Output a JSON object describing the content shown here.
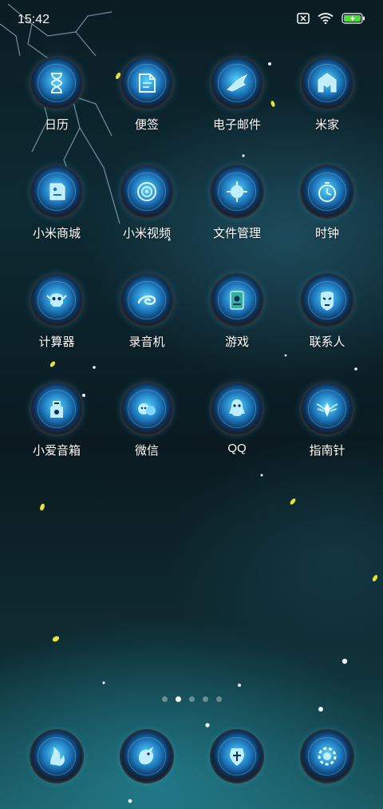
{
  "status_bar": {
    "time": "15:42",
    "icons": [
      "sim-off-icon",
      "wifi-icon",
      "battery-charging-icon"
    ],
    "battery_color": "#4ddc3a"
  },
  "apps": [
    {
      "label": "日历",
      "icon": "hourglass-icon"
    },
    {
      "label": "便签",
      "icon": "note-icon"
    },
    {
      "label": "电子邮件",
      "icon": "wing-mail-icon"
    },
    {
      "label": "米家",
      "icon": "mi-home-icon"
    },
    {
      "label": "小米商城",
      "icon": "shop-tag-icon"
    },
    {
      "label": "小米视频",
      "icon": "video-vortex-icon"
    },
    {
      "label": "文件管理",
      "icon": "file-orb-icon"
    },
    {
      "label": "时钟",
      "icon": "stopwatch-icon"
    },
    {
      "label": "计算器",
      "icon": "calculator-skull-icon"
    },
    {
      "label": "录音机",
      "icon": "recorder-swirl-icon"
    },
    {
      "label": "游戏",
      "icon": "game-card-icon"
    },
    {
      "label": "联系人",
      "icon": "mask-icon"
    },
    {
      "label": "小爱音箱",
      "icon": "speaker-knight-icon"
    },
    {
      "label": "微信",
      "icon": "wechat-orb-icon"
    },
    {
      "label": "QQ",
      "icon": "qq-penguin-icon"
    },
    {
      "label": "指南针",
      "icon": "compass-wings-icon"
    }
  ],
  "page_indicator": {
    "count": 5,
    "active_index": 1
  },
  "dock": [
    {
      "icon": "phone-flame-icon"
    },
    {
      "icon": "message-bird-icon"
    },
    {
      "icon": "browser-shield-icon"
    },
    {
      "icon": "camera-gear-icon"
    }
  ],
  "colors": {
    "accent": "#57d6ff",
    "ring": "#2a2f35",
    "background_top": "#0b1c22",
    "background_bottom": "#1a5a62"
  }
}
